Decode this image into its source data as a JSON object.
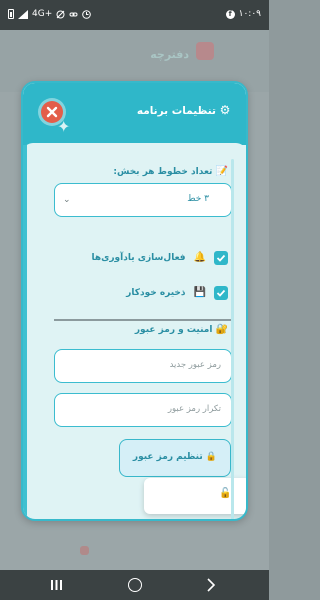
{
  "status_bar": {
    "time": "۱۰:۰۹",
    "network": "4G+",
    "battery_icon": "battery-icon",
    "signal_icon": "signal-icon",
    "facebook_icon": "facebook-icon"
  },
  "background": {
    "title": "دفترچه"
  },
  "modal": {
    "title": "تنظیمات برنامه",
    "gear_icon": "gear-icon",
    "close_icon": "close-icon",
    "lines_section": {
      "label": "تعداد خطوط هر بخش:",
      "emoji": "📝",
      "selected": "۳ خط"
    },
    "reminders": {
      "label": "فعال‌سازی یادآوری‌ها",
      "emoji": "🔔",
      "checked": true
    },
    "autosave": {
      "label": "ذخیره خودکار",
      "emoji": "💾",
      "checked": true
    },
    "security": {
      "label": "امنیت و رمز عبور",
      "emoji": "🔐"
    },
    "new_password_placeholder": "رمز عبور جدید",
    "repeat_password_placeholder": "تکرار رمز عبور",
    "set_password_button": "تنظیم رمز عبور",
    "set_password_emoji": "🔒",
    "popup_emoji": "🔓"
  },
  "nav_bar": {
    "recents_icon": "recents-icon",
    "home_icon": "home-icon",
    "back_icon": "back-icon"
  },
  "colors": {
    "accent": "#2fb7c9",
    "close": "#e35e4a",
    "text": "#2a8ea3"
  }
}
